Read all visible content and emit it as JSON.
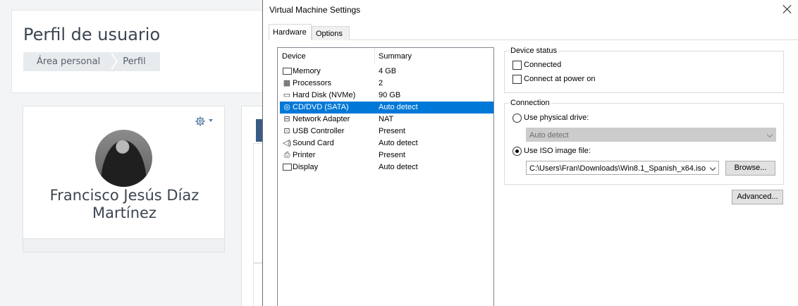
{
  "background_page": {
    "title": "Perfil de usuario",
    "breadcrumb": [
      "Área personal",
      "Perfil"
    ],
    "profile": {
      "name": "Francisco Jesús Díaz Martínez",
      "settings_icon": "gear-icon"
    }
  },
  "dialog": {
    "title": "Virtual Machine Settings",
    "tabs": [
      {
        "label": "Hardware",
        "active": true
      },
      {
        "label": "Options",
        "active": false
      }
    ],
    "device_list": {
      "headers": {
        "device": "Device",
        "summary": "Summary"
      },
      "rows": [
        {
          "icon": "memory-icon",
          "device": "Memory",
          "summary": "4 GB",
          "selected": false
        },
        {
          "icon": "processor-icon",
          "device": "Processors",
          "summary": "2",
          "selected": false
        },
        {
          "icon": "hard-disk-icon",
          "device": "Hard Disk (NVMe)",
          "summary": "90 GB",
          "selected": false
        },
        {
          "icon": "cd-dvd-icon",
          "device": "CD/DVD (SATA)",
          "summary": "Auto detect",
          "selected": true
        },
        {
          "icon": "network-adapter-icon",
          "device": "Network Adapter",
          "summary": "NAT",
          "selected": false
        },
        {
          "icon": "usb-controller-icon",
          "device": "USB Controller",
          "summary": "Present",
          "selected": false
        },
        {
          "icon": "sound-card-icon",
          "device": "Sound Card",
          "summary": "Auto detect",
          "selected": false
        },
        {
          "icon": "printer-icon",
          "device": "Printer",
          "summary": "Present",
          "selected": false
        },
        {
          "icon": "display-icon",
          "device": "Display",
          "summary": "Auto detect",
          "selected": false
        }
      ]
    },
    "device_status": {
      "label": "Device status",
      "connected_label": "Connected",
      "connected": false,
      "connect_power_on_label": "Connect at power on",
      "connect_power_on": false
    },
    "connection": {
      "label": "Connection",
      "physical_drive_label": "Use physical drive:",
      "physical_drive_selected": false,
      "physical_drive_value": "Auto detect",
      "iso_label": "Use ISO image file:",
      "iso_selected": true,
      "iso_path": "C:\\Users\\Fran\\Downloads\\Win8.1_Spanish_x64.iso",
      "browse_label": "Browse..."
    },
    "advanced_label": "Advanced..."
  }
}
